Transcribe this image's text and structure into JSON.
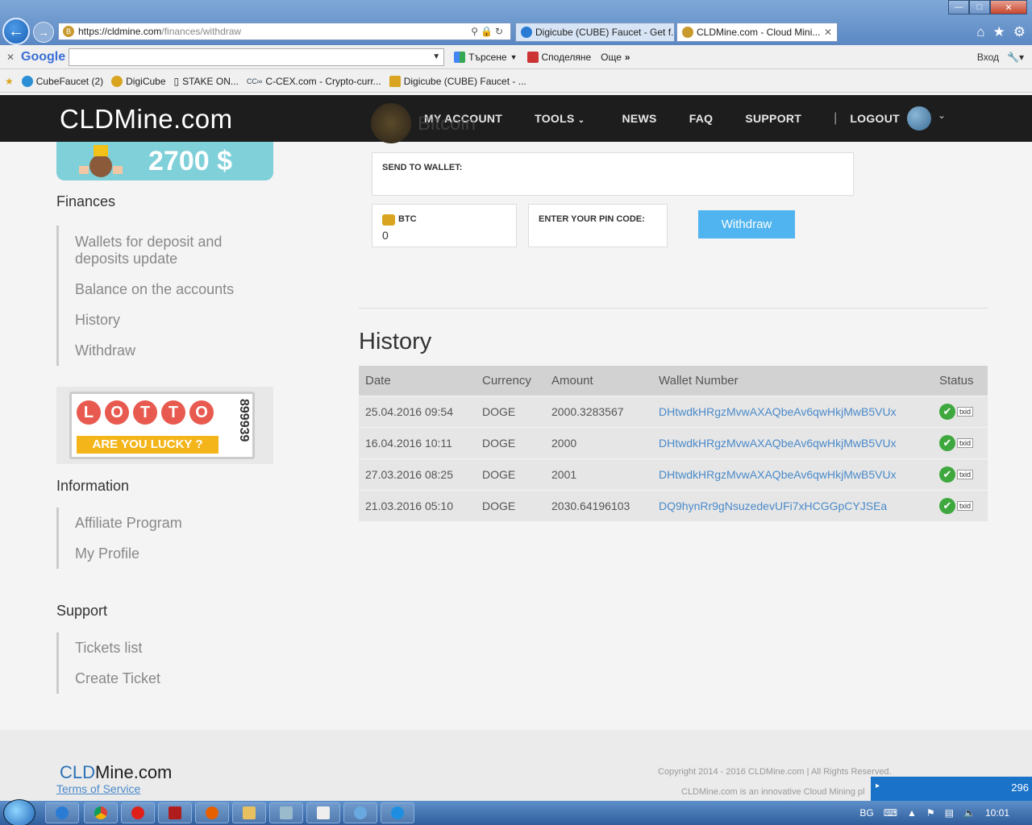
{
  "browser": {
    "url_host": "https://cldmine.com",
    "url_path": "/finances/withdraw",
    "tabs": [
      {
        "label": "Digicube (CUBE) Faucet - Get f...",
        "active": false
      },
      {
        "label": "CLDMine.com - Cloud Mini...",
        "active": true
      }
    ],
    "google": {
      "logo": "Google",
      "search_label": "Търсене",
      "share_label": "Споделяне",
      "more_label": "Още",
      "signin_label": "Вход"
    },
    "favorites": [
      {
        "label": "CubeFaucet (2)"
      },
      {
        "label": "DigiCube"
      },
      {
        "label": "STAKE ON..."
      },
      {
        "label": "C-CEX.com - Crypto-curr..."
      },
      {
        "label": "Digicube (CUBE) Faucet - ..."
      }
    ]
  },
  "header": {
    "logo": "CLDMine.com",
    "nav": {
      "my_account": "MY ACCOUNT",
      "tools": "TOOLS",
      "news": "NEWS",
      "faq": "FAQ",
      "support": "SUPPORT",
      "logout": "LOGOUT"
    }
  },
  "sidebar": {
    "promo_amount": "2700 $",
    "finances": {
      "heading": "Finances",
      "items": [
        "Wallets for deposit and deposits update",
        "Balance on the accounts",
        "History",
        "Withdraw"
      ]
    },
    "lotto": {
      "letters": [
        "L",
        "O",
        "T",
        "T",
        "O"
      ],
      "ribbon": "ARE YOU LUCKY ?",
      "number": "899939"
    },
    "information": {
      "heading": "Information",
      "items": [
        "Affiliate Program",
        "My Profile"
      ]
    },
    "support": {
      "heading": "Support",
      "items": [
        "Tickets list",
        "Create Ticket"
      ]
    }
  },
  "withdraw": {
    "currency_title": "Bitcoin",
    "send_to_wallet_label": "SEND TO WALLET:",
    "btc_label": "BTC",
    "btc_value": "0",
    "pin_label": "ENTER YOUR PIN CODE:",
    "button_label": "Withdraw"
  },
  "history": {
    "title": "History",
    "columns": [
      "Date",
      "Currency",
      "Amount",
      "Wallet Number",
      "Status"
    ],
    "rows": [
      {
        "date": "25.04.2016 09:54",
        "currency": "DOGE",
        "amount": "2000.3283567",
        "wallet": "DHtwdkHRgzMvwAXAQbeAv6qwHkjMwB5VUx",
        "txid": "txid"
      },
      {
        "date": "16.04.2016 10:11",
        "currency": "DOGE",
        "amount": "2000",
        "wallet": "DHtwdkHRgzMvwAXAQbeAv6qwHkjMwB5VUx",
        "txid": "txid"
      },
      {
        "date": "27.03.2016 08:25",
        "currency": "DOGE",
        "amount": "2001",
        "wallet": "DHtwdkHRgzMvwAXAQbeAv6qwHkjMwB5VUx",
        "txid": "txid"
      },
      {
        "date": "21.03.2016 05:10",
        "currency": "DOGE",
        "amount": "2030.64196103",
        "wallet": "DQ9hynRr9gNsuzedevUFi7xHCGGpCYJSEa",
        "txid": "txid"
      }
    ]
  },
  "footer": {
    "logo_a": "CLD",
    "logo_b": "Mine.com",
    "tos": "Terms of Service",
    "copyright": "Copyright 2014 - 2016 CLDMine.com | All Rights Reserved.",
    "desc": "CLDMine.com is an innovative Cloud Mining pl",
    "notice_count": "296"
  },
  "taskbar": {
    "lang": "BG",
    "time": "10:01"
  },
  "colors": {
    "header_bg": "#1d1d1d",
    "accent_button": "#4fb4ef",
    "link": "#4a8ac9",
    "status_ok": "#3ea83e"
  }
}
